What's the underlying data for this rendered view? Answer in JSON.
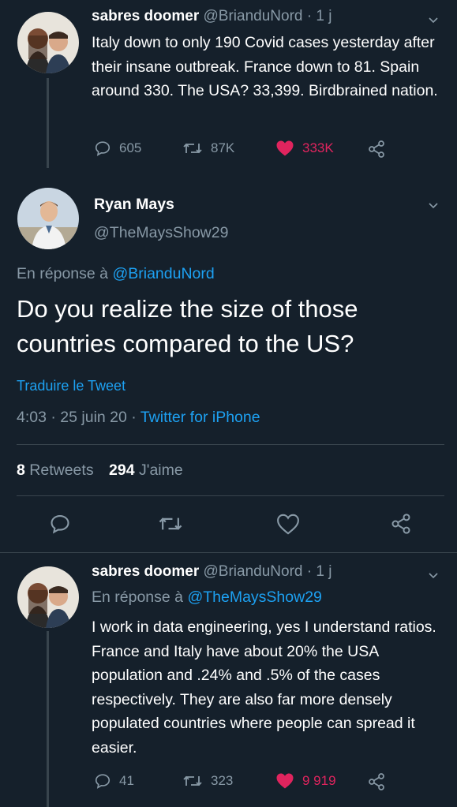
{
  "tweet1": {
    "name": "sabres doomer",
    "handle_time": "@BrianduNord · 1 j",
    "text": "Italy down to only 190 Covid cases yesterday after their insane outbreak. France down to 81. Spain around 330. The USA? 33,399. Birdbrained nation.",
    "replies": "605",
    "retweets": "87K",
    "likes": "333K",
    "liked": true
  },
  "main": {
    "name": "Ryan Mays",
    "handle": "@TheMaysShow29",
    "reply_prefix": "En réponse à",
    "reply_to": "@BrianduNord",
    "text": "Do you realize the size of those countries compared to the US?",
    "translate": "Traduire le Tweet",
    "timestamp": "4:03 · 25 juin 20 ·",
    "source": "Twitter for iPhone",
    "retweet_count": "8",
    "retweet_label": "Retweets",
    "like_count": "294",
    "like_label": "J'aime"
  },
  "tweet2": {
    "name": "sabres doomer",
    "handle_time": "@BrianduNord · 1 j",
    "reply_prefix": "En réponse à",
    "reply_to": "@TheMaysShow29",
    "text": "I work in data engineering, yes I understand ratios. France and Italy have about 20% the USA population and .24% and .5% of the cases respectively. They are also far more densely populated countries where people can spread it easier.",
    "replies": "41",
    "retweets": "323",
    "likes": "9 919",
    "liked": true
  },
  "colors": {
    "background": "#15202b",
    "accent": "#1da1f2",
    "like": "#e0245e",
    "muted": "#8899a6",
    "divider": "#38444d"
  },
  "icons": [
    "reply-icon",
    "retweet-icon",
    "heart-icon",
    "share-icon",
    "chevron-down-icon"
  ]
}
